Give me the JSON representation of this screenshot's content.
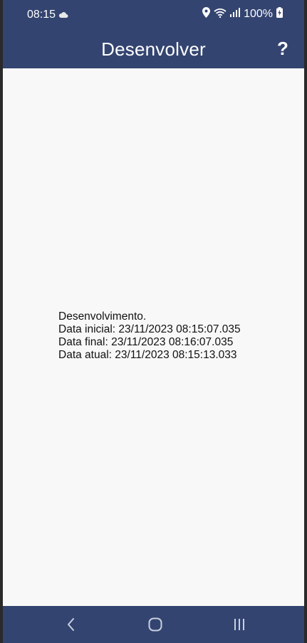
{
  "status_bar": {
    "time": "08:15",
    "battery": "100%"
  },
  "app_bar": {
    "title": "Desenvolver",
    "help_label": "?"
  },
  "content": {
    "lines": [
      "Desenvolvimento.",
      "Data inicial: 23/11/2023 08:15:07.035",
      "Data final: 23/11/2023 08:16:07.035",
      "Data atual: 23/11/2023 08:15:13.033"
    ]
  },
  "icons": {
    "weather": "cloud-icon",
    "location": "location-icon",
    "wifi": "wifi-icon",
    "signal": "signal-icon",
    "battery": "battery-charging-icon",
    "back": "back-icon",
    "home": "home-icon",
    "recents": "recents-icon"
  },
  "colors": {
    "bar": "#334470",
    "background": "#f8f8f8",
    "text": "#111111"
  }
}
